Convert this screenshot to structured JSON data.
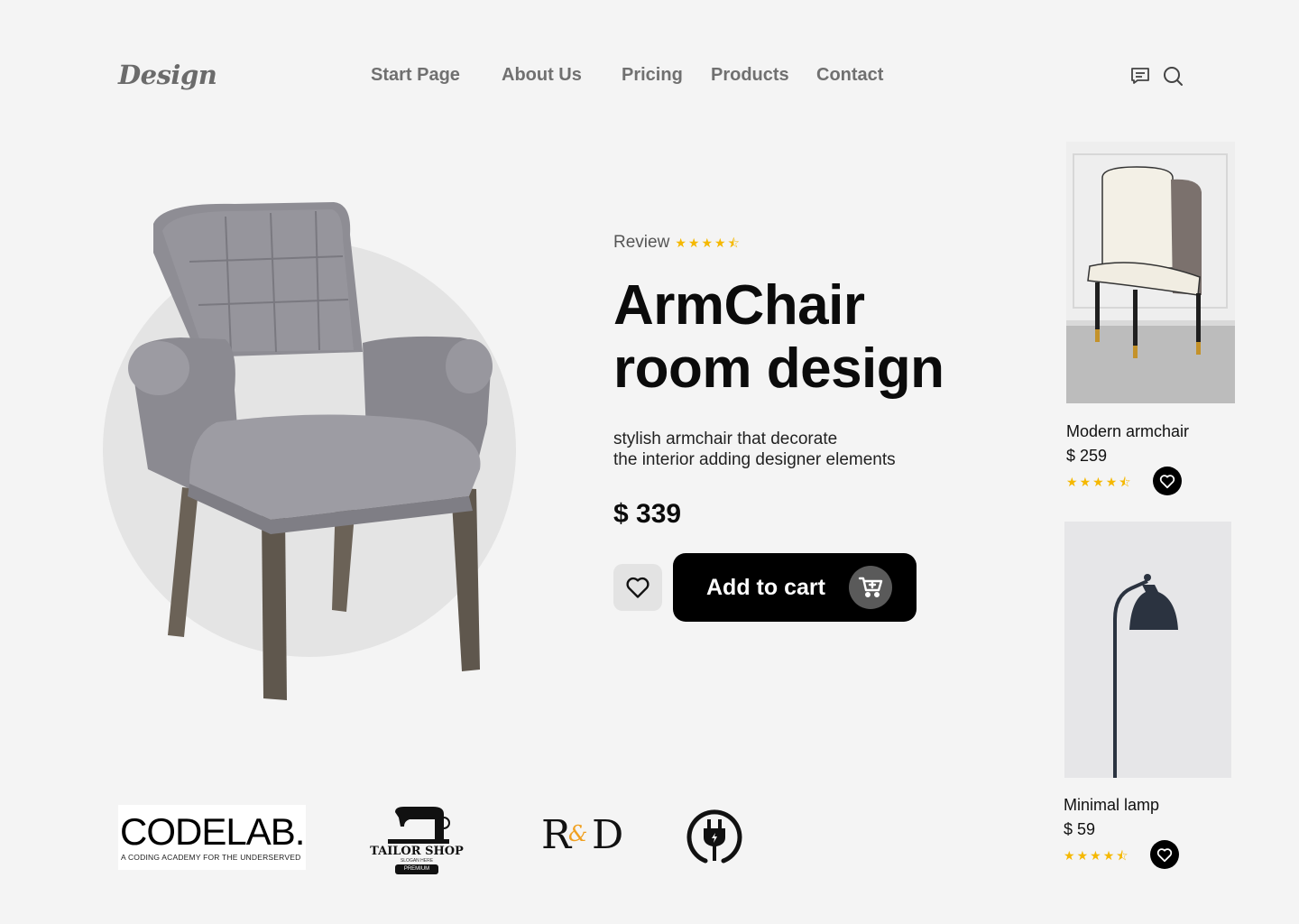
{
  "header": {
    "logo": "Design",
    "nav": [
      "Start Page",
      "About Us",
      "Pricing",
      "Products",
      "Contact"
    ],
    "icons": [
      "message-icon",
      "search-icon"
    ]
  },
  "hero": {
    "review_label": "Review",
    "rating": 4.5,
    "title_line1": "ArmChair",
    "title_line2": "room design",
    "desc_line1": "stylish armchair that decorate",
    "desc_line2": "the interior adding designer elements",
    "price": "$ 339",
    "add_to_cart": "Add to cart",
    "colors": {
      "accent": "#000000",
      "star": "#f5b800",
      "circle": "#e4e4e4"
    }
  },
  "products": [
    {
      "name": "Modern armchair",
      "price": "$ 259",
      "rating": 4.5
    },
    {
      "name": "Minimal lamp",
      "price": "$ 59",
      "rating": 4.5
    }
  ],
  "brands": {
    "codelab": {
      "name": "CODELAB.",
      "tagline": "A CODING ACADEMY FOR THE UNDERSERVED"
    },
    "tailor": {
      "name": "TAILOR SHOP",
      "slogan": "SLOGAN HERE",
      "badge": "PREMIUM"
    },
    "rd": {
      "left": "R",
      "amp": "&",
      "right": "D"
    },
    "plug_icon": "plug-icon"
  }
}
